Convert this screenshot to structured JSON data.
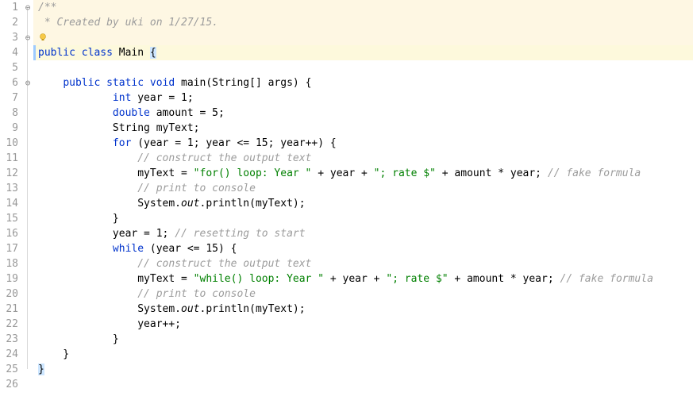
{
  "lines": [
    {
      "n": 1,
      "bg": "hl-comment-block",
      "fold": "⊖",
      "tokens": [
        [
          "c-doc",
          "/**"
        ]
      ]
    },
    {
      "n": 2,
      "bg": "hl-comment-block",
      "fold": "",
      "tokens": [
        [
          "c-doc",
          " * Created by uki on 1/27/15."
        ]
      ]
    },
    {
      "n": 3,
      "bg": "hl-comment-block",
      "fold": "⊖",
      "tokens": [
        [
          "c-doc",
          " "
        ]
      ],
      "bulb": true
    },
    {
      "n": 4,
      "bg": "hl-class-line",
      "fold": "",
      "caret": true,
      "tokens": [
        [
          "c-key",
          "public class "
        ],
        [
          "c-plain",
          "Main "
        ],
        [
          "c-brace-hl",
          "{"
        ]
      ]
    },
    {
      "n": 5,
      "bg": "",
      "fold": "",
      "tokens": [
        [
          "c-plain",
          ""
        ]
      ]
    },
    {
      "n": 6,
      "bg": "",
      "fold": "⊖",
      "tokens": [
        [
          "c-plain",
          "    "
        ],
        [
          "c-key",
          "public static void "
        ],
        [
          "c-plain",
          "main(String[] args) {"
        ]
      ]
    },
    {
      "n": 7,
      "bg": "",
      "fold": "",
      "tokens": [
        [
          "c-plain",
          "            "
        ],
        [
          "c-key",
          "int "
        ],
        [
          "c-plain",
          "year = "
        ],
        [
          "c-plain",
          "1"
        ],
        [
          "c-plain",
          ";"
        ]
      ]
    },
    {
      "n": 8,
      "bg": "",
      "fold": "",
      "tokens": [
        [
          "c-plain",
          "            "
        ],
        [
          "c-key",
          "double "
        ],
        [
          "c-plain",
          "amount = "
        ],
        [
          "c-plain",
          "5"
        ],
        [
          "c-plain",
          ";"
        ]
      ]
    },
    {
      "n": 9,
      "bg": "",
      "fold": "",
      "tokens": [
        [
          "c-plain",
          "            String myText;"
        ]
      ]
    },
    {
      "n": 10,
      "bg": "",
      "fold": "",
      "tokens": [
        [
          "c-plain",
          "            "
        ],
        [
          "c-key",
          "for "
        ],
        [
          "c-plain",
          "(year = "
        ],
        [
          "c-plain",
          "1"
        ],
        [
          "c-plain",
          "; year <= "
        ],
        [
          "c-plain",
          "15"
        ],
        [
          "c-plain",
          "; year++) {"
        ]
      ]
    },
    {
      "n": 11,
      "bg": "",
      "fold": "",
      "tokens": [
        [
          "c-plain",
          "                "
        ],
        [
          "c-comment",
          "// construct the output text"
        ]
      ]
    },
    {
      "n": 12,
      "bg": "",
      "fold": "",
      "tokens": [
        [
          "c-plain",
          "                myText = "
        ],
        [
          "c-str",
          "\"for() loop: Year \""
        ],
        [
          "c-plain",
          " + year + "
        ],
        [
          "c-str",
          "\"; rate $\""
        ],
        [
          "c-plain",
          " + amount * year; "
        ],
        [
          "c-comment",
          "// fake formula"
        ]
      ]
    },
    {
      "n": 13,
      "bg": "",
      "fold": "",
      "tokens": [
        [
          "c-plain",
          "                "
        ],
        [
          "c-comment",
          "// print to console"
        ]
      ]
    },
    {
      "n": 14,
      "bg": "",
      "fold": "",
      "tokens": [
        [
          "c-plain",
          "                System."
        ],
        [
          "c-static",
          "out"
        ],
        [
          "c-plain",
          ".println(myText);"
        ]
      ]
    },
    {
      "n": 15,
      "bg": "",
      "fold": "",
      "tokens": [
        [
          "c-plain",
          "            }"
        ]
      ]
    },
    {
      "n": 16,
      "bg": "",
      "fold": "",
      "tokens": [
        [
          "c-plain",
          "            year = "
        ],
        [
          "c-plain",
          "1"
        ],
        [
          "c-plain",
          "; "
        ],
        [
          "c-comment",
          "// resetting to start"
        ]
      ]
    },
    {
      "n": 17,
      "bg": "",
      "fold": "",
      "tokens": [
        [
          "c-plain",
          "            "
        ],
        [
          "c-key",
          "while "
        ],
        [
          "c-plain",
          "(year <= "
        ],
        [
          "c-plain",
          "15"
        ],
        [
          "c-plain",
          ") {"
        ]
      ]
    },
    {
      "n": 18,
      "bg": "",
      "fold": "",
      "tokens": [
        [
          "c-plain",
          "                "
        ],
        [
          "c-comment",
          "// construct the output text"
        ]
      ]
    },
    {
      "n": 19,
      "bg": "",
      "fold": "",
      "tokens": [
        [
          "c-plain",
          "                myText = "
        ],
        [
          "c-str",
          "\"while() loop: Year \""
        ],
        [
          "c-plain",
          " + year + "
        ],
        [
          "c-str",
          "\"; rate $\""
        ],
        [
          "c-plain",
          " + amount * year; "
        ],
        [
          "c-comment",
          "// fake formula"
        ]
      ]
    },
    {
      "n": 20,
      "bg": "",
      "fold": "",
      "tokens": [
        [
          "c-plain",
          "                "
        ],
        [
          "c-comment",
          "// print to console"
        ]
      ]
    },
    {
      "n": 21,
      "bg": "",
      "fold": "",
      "tokens": [
        [
          "c-plain",
          "                System."
        ],
        [
          "c-static",
          "out"
        ],
        [
          "c-plain",
          ".println(myText);"
        ]
      ]
    },
    {
      "n": 22,
      "bg": "",
      "fold": "",
      "tokens": [
        [
          "c-plain",
          "                year++;"
        ]
      ]
    },
    {
      "n": 23,
      "bg": "",
      "fold": "",
      "tokens": [
        [
          "c-plain",
          "            }"
        ]
      ]
    },
    {
      "n": 24,
      "bg": "",
      "fold": "",
      "tokens": [
        [
          "c-plain",
          "    }"
        ]
      ]
    },
    {
      "n": 25,
      "bg": "",
      "fold": "",
      "tokens": [
        [
          "c-brace-hl",
          "}"
        ]
      ]
    },
    {
      "n": 26,
      "bg": "",
      "fold": "",
      "tokens": [
        [
          "c-plain",
          ""
        ]
      ]
    }
  ],
  "fold_line_ranges": [
    {
      "from": 1,
      "to": 25
    }
  ]
}
